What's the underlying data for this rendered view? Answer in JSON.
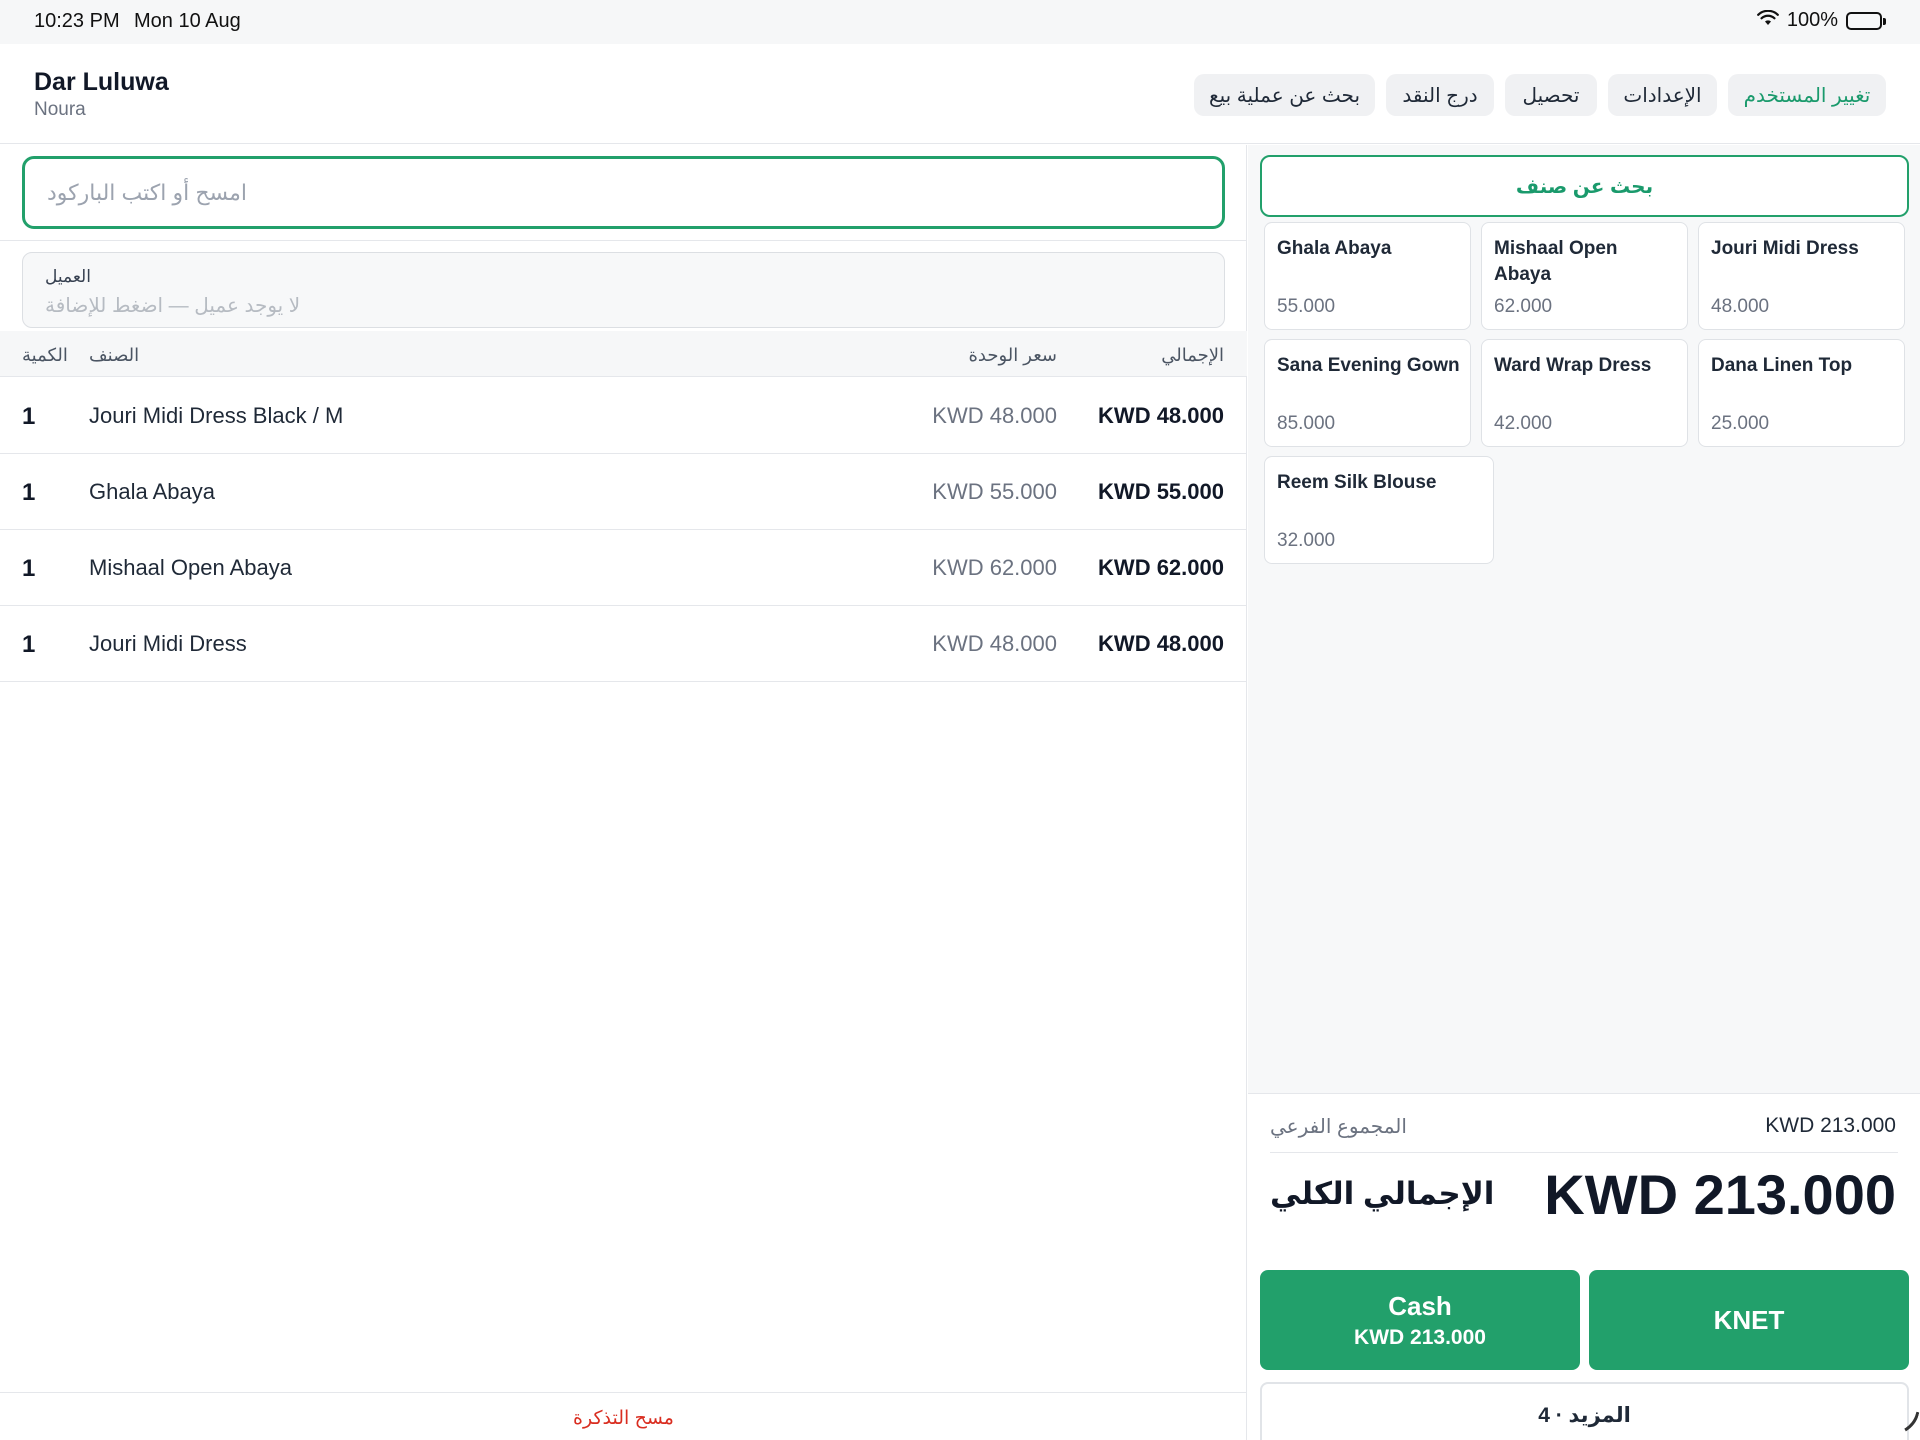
{
  "status_bar": {
    "time": "10:23 PM",
    "date": "Mon 10 Aug",
    "battery": "100%",
    "wifi_icon": "wifi-icon",
    "battery_icon": "battery-icon"
  },
  "header": {
    "store_name": "Dar Luluwa",
    "user_name": "Noura",
    "buttons": {
      "switch_user": "تغيير المستخدم",
      "settings": "الإعدادات",
      "collection": "تحصيل",
      "cash_drawer": "درج النقد",
      "find_sale": "بحث عن عملية بيع"
    }
  },
  "ticket": {
    "barcode_placeholder": "امسح أو اكتب الباركود",
    "customer": {
      "label": "العميل",
      "hint": "لا يوجد عميل — اضغط للإضافة"
    },
    "columns": {
      "qty": "الكمية",
      "item": "الصنف",
      "unit_price": "سعر الوحدة",
      "total": "الإجمالي"
    },
    "lines": [
      {
        "qty": "1",
        "name": "Jouri Midi Dress Black / M",
        "unit_price": "KWD 48.000",
        "total": "KWD 48.000"
      },
      {
        "qty": "1",
        "name": "Ghala Abaya",
        "unit_price": "KWD 55.000",
        "total": "KWD 55.000"
      },
      {
        "qty": "1",
        "name": "Mishaal Open Abaya",
        "unit_price": "KWD 62.000",
        "total": "KWD 62.000"
      },
      {
        "qty": "1",
        "name": "Jouri Midi Dress",
        "unit_price": "KWD 48.000",
        "total": "KWD 48.000"
      }
    ],
    "clear_ticket": "مسح التذكرة"
  },
  "catalog": {
    "search_button": "بحث عن صنف",
    "items": [
      {
        "name": "Ghala Abaya",
        "price": "55.000"
      },
      {
        "name": "Mishaal Open Abaya",
        "price": "62.000"
      },
      {
        "name": "Jouri Midi Dress",
        "price": "48.000"
      },
      {
        "name": "Sana Evening Gown",
        "price": "85.000"
      },
      {
        "name": "Ward Wrap Dress",
        "price": "42.000"
      },
      {
        "name": "Dana Linen Top",
        "price": "25.000"
      },
      {
        "name": "Reem Silk Blouse",
        "price": "32.000"
      }
    ]
  },
  "summary": {
    "subtotal_label": "المجموع الفرعي",
    "subtotal_value": "KWD 213.000",
    "total_label": "الإجمالي الكلي",
    "total_value": "KWD 213.000",
    "cash_label": "Cash",
    "cash_amount": "KWD 213.000",
    "knet_label": "KNET",
    "more_label": "المزيد · 4"
  },
  "colors": {
    "accent": "#22a06b",
    "danger": "#d92d20"
  }
}
